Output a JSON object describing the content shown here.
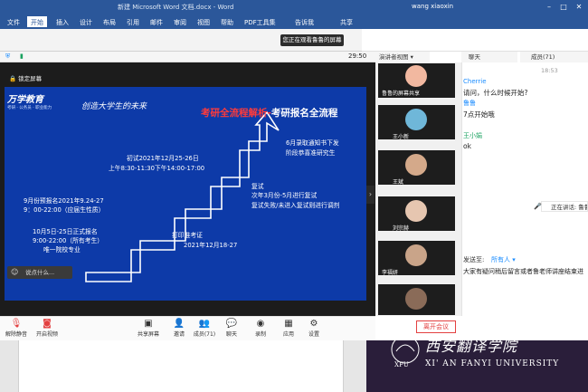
{
  "word": {
    "title": "新建 Microsoft Word 文档.docx - Word",
    "user": "wang xiaoxin",
    "tabs": [
      "文件",
      "开始",
      "插入",
      "设计",
      "布局",
      "引用",
      "邮件",
      "审阅",
      "视图",
      "帮助",
      "PDF工具集",
      "告诉我",
      "共享"
    ],
    "active_tab": "开始"
  },
  "meeting": {
    "share_banner": "您正在观看鲁鲁的屏幕",
    "time": "29:50",
    "gallery_label": "演讲者视图",
    "lock_label": "锁定屏幕",
    "chat_header": "聊天",
    "members_header": "成员(71)",
    "say_placeholder": "说点什么...",
    "leave_label": "离开会议",
    "speaking_label": "正在讲话: 鲁鲁"
  },
  "slide": {
    "logo_text": "万学教育",
    "logo_sub": "考研 · 公务员 · 职业能力",
    "slogan": "创造大学生的未来",
    "title_red": "考研全流程解析-",
    "title_white": "考研报名全流程",
    "steps": {
      "pre_reg_1": "9月份预报名2021年9.24-27",
      "pre_reg_2": "9：00-22:00（应届生性质）",
      "reg_1": "10月5日-25日正式报名",
      "reg_2": "9:00-22:00（所有考生）",
      "reg_3": "唯一院校专业",
      "exam_1": "初试2021年12月25-26日",
      "exam_2": "上午8:30-11:30下午14:00-17:00",
      "ticket_1": "打印准考证",
      "ticket_2": "2021年12月18-27",
      "retest_1": "复试",
      "retest_2": "次年3月份-5月进行复试",
      "retest_3": "复试失败/未进入复试则进行调剂",
      "admit_1": "6月录取通知书下发",
      "admit_2": "阶段恭喜准研究生"
    }
  },
  "tiles": [
    {
      "name": "鲁鲁的屏幕共享",
      "color": "#f2b8a0"
    },
    {
      "name": "王小新",
      "color": "#6fb7d9"
    },
    {
      "name": "王斌",
      "color": "#d4a98a"
    },
    {
      "name": "刘宗赫",
      "color": "#e6c6b0"
    },
    {
      "name": "李福妍",
      "color": "#c9a489"
    },
    {
      "name": "",
      "color": "#8a6b58"
    }
  ],
  "chat": {
    "time": "18:53",
    "messages": [
      {
        "name": "Cherrie",
        "text": "请问，什么时候开始?",
        "green": false
      },
      {
        "name": "鲁鲁",
        "text": "7点开始哦",
        "green": false
      },
      {
        "name": "王小娟",
        "text": "ok",
        "green": true
      }
    ],
    "send_to_label": "发送至:",
    "send_to_target": "所有人",
    "input_text": "大家有疑问稍后留言或者鲁老师讲座结束进"
  },
  "toolbar": {
    "mute": "解除静音",
    "video": "开启视频",
    "share": "共享屏幕",
    "invite": "邀请",
    "members": "成员(71)",
    "chat": "聊天",
    "record": "录制",
    "apps": "应用",
    "settings": "设置"
  },
  "watermark": {
    "cn": "西安翻译学院",
    "en": "XI' AN FANYI UNIVERSITY",
    "abbr": "XFU"
  }
}
